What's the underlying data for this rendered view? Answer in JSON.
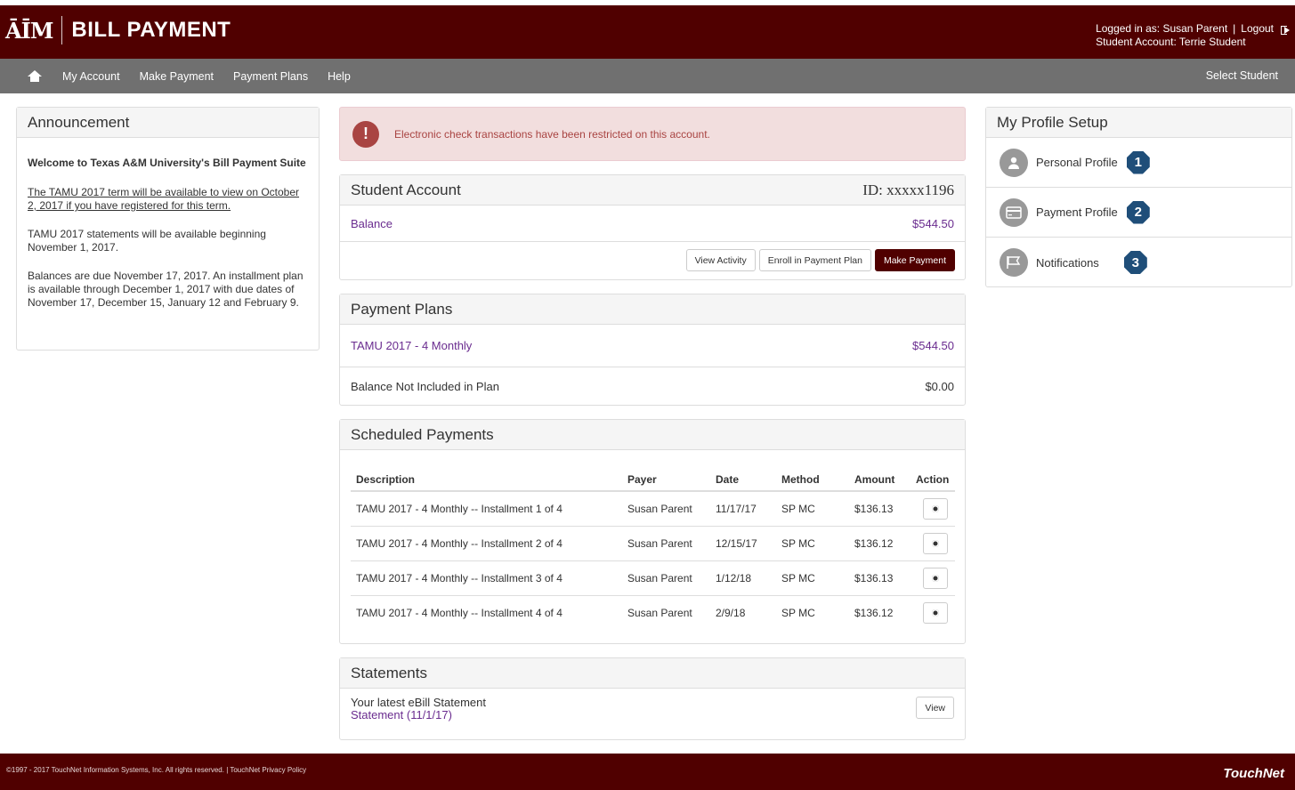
{
  "header": {
    "logo_mark": "ĀĪM",
    "title": "BILL PAYMENT",
    "logged_in_label": "Logged in as: Susan Parent",
    "separator": "|",
    "logout_label": "Logout",
    "student_account_label": "Student Account: Terrie Student"
  },
  "nav": {
    "items": [
      "My Account",
      "Make Payment",
      "Payment Plans",
      "Help"
    ],
    "right_link": "Select Student"
  },
  "announcement": {
    "title": "Announcement",
    "welcome": "Welcome to Texas A&M University's Bill Payment Suite",
    "link_text": "The TAMU 2017 term will be available to view on October 2, 2017 if you have registered for this term.",
    "paragraph1": "TAMU 2017 statements will be available beginning November 1, 2017.",
    "paragraph2": "Balances are due November 17, 2017. An installment plan is available through December 1, 2017 with due dates of November 17, December 15, January 12 and February 9."
  },
  "alert": {
    "icon": "!",
    "message": "Electronic check transactions have been restricted on this account."
  },
  "student_account": {
    "title": "Student Account",
    "id_label": "ID: xxxxx1196",
    "balance_label": "Balance",
    "balance_value": "$544.50",
    "buttons": {
      "view_activity": "View Activity",
      "enroll": "Enroll in Payment Plan",
      "make_payment": "Make Payment"
    }
  },
  "payment_plans": {
    "title": "Payment Plans",
    "plan_name": "TAMU 2017 - 4 Monthly",
    "plan_amount": "$544.50",
    "not_included_label": "Balance Not Included in Plan",
    "not_included_amount": "$0.00"
  },
  "scheduled_payments": {
    "title": "Scheduled Payments",
    "columns": [
      "Description",
      "Payer",
      "Date",
      "Method",
      "Amount",
      "Action"
    ],
    "rows": [
      {
        "description": "TAMU 2017 - 4 Monthly -- Installment 1 of 4",
        "payer": "Susan Parent",
        "date": "11/17/17",
        "method": "SP MC",
        "amount": "$136.13"
      },
      {
        "description": "TAMU 2017 - 4 Monthly -- Installment 2 of 4",
        "payer": "Susan Parent",
        "date": "12/15/17",
        "method": "SP MC",
        "amount": "$136.12"
      },
      {
        "description": "TAMU 2017 - 4 Monthly -- Installment 3 of 4",
        "payer": "Susan Parent",
        "date": "1/12/18",
        "method": "SP MC",
        "amount": "$136.13"
      },
      {
        "description": "TAMU 2017 - 4 Monthly -- Installment 4 of 4",
        "payer": "Susan Parent",
        "date": "2/9/18",
        "method": "SP MC",
        "amount": "$136.12"
      }
    ]
  },
  "statements": {
    "title": "Statements",
    "latest_label": "Your latest eBill Statement",
    "statement_link": "Statement (11/1/17)",
    "view_button": "View"
  },
  "profile_setup": {
    "title": "My Profile Setup",
    "items": [
      {
        "label": "Personal Profile",
        "badge": "1",
        "icon": "user-icon"
      },
      {
        "label": "Payment Profile",
        "badge": "2",
        "icon": "credit-card-icon"
      },
      {
        "label": "Notifications",
        "badge": "3",
        "icon": "flag-icon"
      }
    ]
  },
  "footer": {
    "copyright": "©1997 - 2017 TouchNet Information Systems, Inc. All rights reserved. | TouchNet Privacy Policy",
    "brand": "TouchNet"
  },
  "colors": {
    "maroon": "#500000",
    "nav_gray": "#707070",
    "link_purple": "#6a2c8f",
    "alert_bg": "#f2dede",
    "alert_text": "#a94442",
    "badge_blue": "#1f4e79"
  }
}
